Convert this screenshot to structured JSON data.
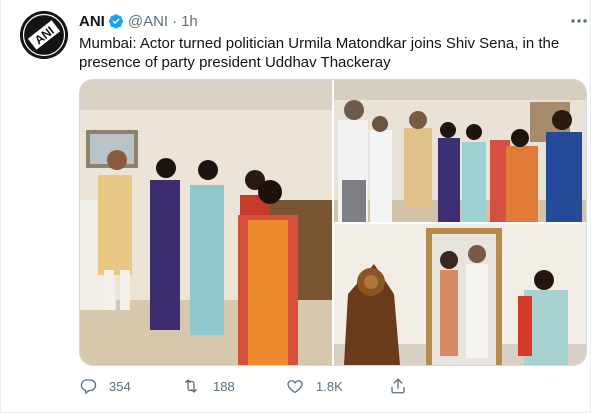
{
  "tweet": {
    "author_name": "ANI",
    "handle": "@ANI",
    "separator": "·",
    "time": "1h",
    "text": "Mumbai: Actor turned politician Urmila Matondkar joins Shiv Sena, in the presence of party president Uddhav Thackeray",
    "avatar_text": "ANI",
    "verified_icon": "verified-badge-icon",
    "accent_color": "#1da1f2"
  },
  "actions": {
    "replies": "354",
    "retweets": "188",
    "likes": "1.8K"
  }
}
